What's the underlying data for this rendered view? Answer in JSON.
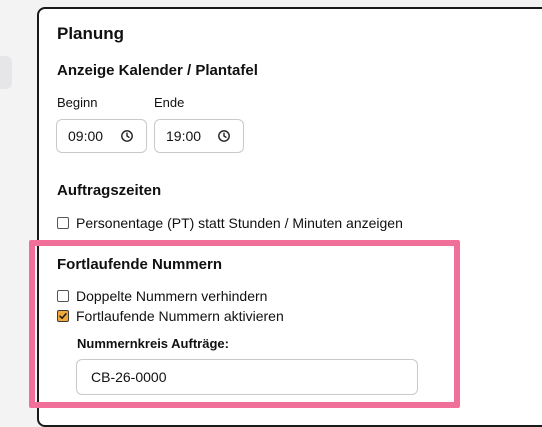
{
  "planung": {
    "title": "Planung",
    "calendar": {
      "title": "Anzeige Kalender / Plantafel",
      "start_label": "Beginn",
      "start_value": "09:00",
      "end_label": "Ende",
      "end_value": "19:00"
    },
    "order_times": {
      "title": "Auftragszeiten",
      "pt_checkbox_label": "Personentage (PT) statt Stunden / Minuten anzeigen",
      "pt_checked": false
    },
    "sequential_numbers": {
      "title": "Fortlaufende Nummern",
      "prevent_duplicates_label": "Doppelte Nummern verhindern",
      "prevent_duplicates_checked": false,
      "activate_label": "Fortlaufende Nummern aktivieren",
      "activate_checked": true,
      "number_range_label": "Nummernkreis Aufträge:",
      "number_range_value": "CB-26-0000"
    }
  },
  "colors": {
    "highlight": "#f0709a",
    "checkbox_checked": "#f2a93b"
  },
  "icons": {
    "time": "clock-icon",
    "check": "checkmark-icon"
  }
}
